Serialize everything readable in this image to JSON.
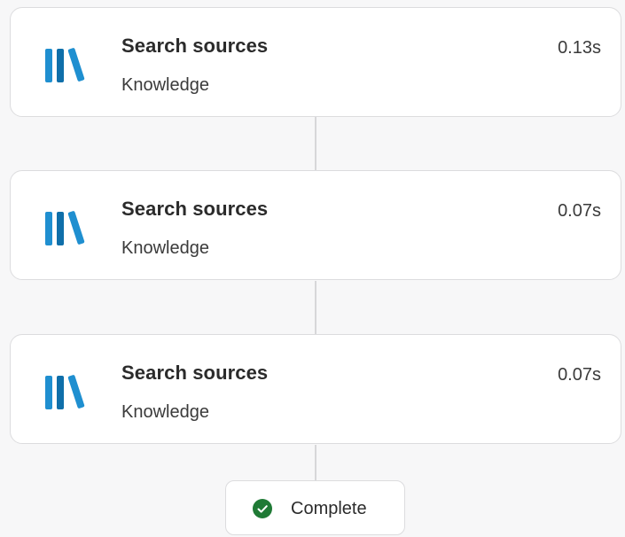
{
  "steps": [
    {
      "title": "Search sources",
      "subtitle": "Knowledge",
      "duration": "0.13s",
      "icon": "books-icon"
    },
    {
      "title": "Search sources",
      "subtitle": "Knowledge",
      "duration": "0.07s",
      "icon": "books-icon"
    },
    {
      "title": "Search sources",
      "subtitle": "Knowledge",
      "duration": "0.07s",
      "icon": "books-icon"
    }
  ],
  "status": {
    "label": "Complete",
    "icon": "check-circle-icon",
    "color": "#1f7a35"
  },
  "colors": {
    "icon_blue": "#1f8fd0",
    "icon_blue_dark": "#0f6faa",
    "connector": "#d7d7d9"
  }
}
